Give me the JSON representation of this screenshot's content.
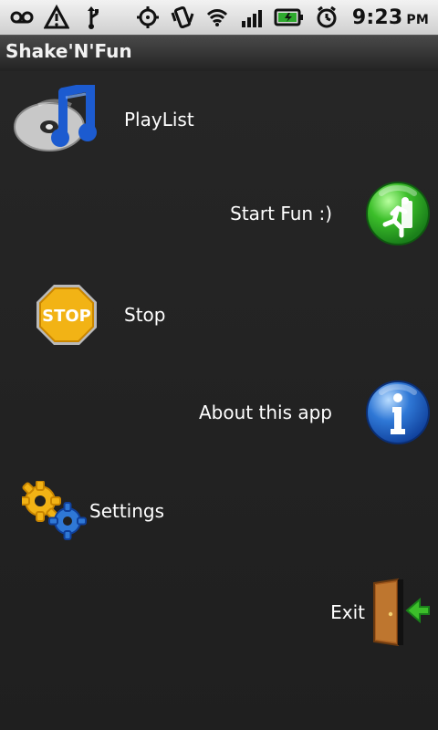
{
  "status_bar": {
    "time": "9:23",
    "ampm": "PM",
    "icons": [
      "voicemail-icon",
      "warning-icon",
      "usb-icon",
      "gps-icon",
      "vibrate-icon",
      "wifi-icon",
      "signal-icon",
      "battery-icon",
      "alarm-icon"
    ]
  },
  "app": {
    "title": "Shake'N'Fun"
  },
  "menu": [
    {
      "id": "playlist",
      "label": "PlayList",
      "icon": "playlist-icon"
    },
    {
      "id": "start",
      "label": "Start Fun :)",
      "icon": "running-man-icon"
    },
    {
      "id": "stop",
      "label": "Stop",
      "icon": "stop-sign-icon"
    },
    {
      "id": "about",
      "label": "About this app",
      "icon": "info-icon"
    },
    {
      "id": "settings",
      "label": "Settings",
      "icon": "gears-icon"
    },
    {
      "id": "exit",
      "label": "Exit",
      "icon": "exit-door-icon"
    }
  ],
  "colors": {
    "background": "#202020",
    "statusbar": "#e6e6e6",
    "titlebar": "#2d2d2d",
    "start_green": "#3cbf2a",
    "info_blue": "#2f78d6",
    "stop_yellow": "#f2b315"
  }
}
